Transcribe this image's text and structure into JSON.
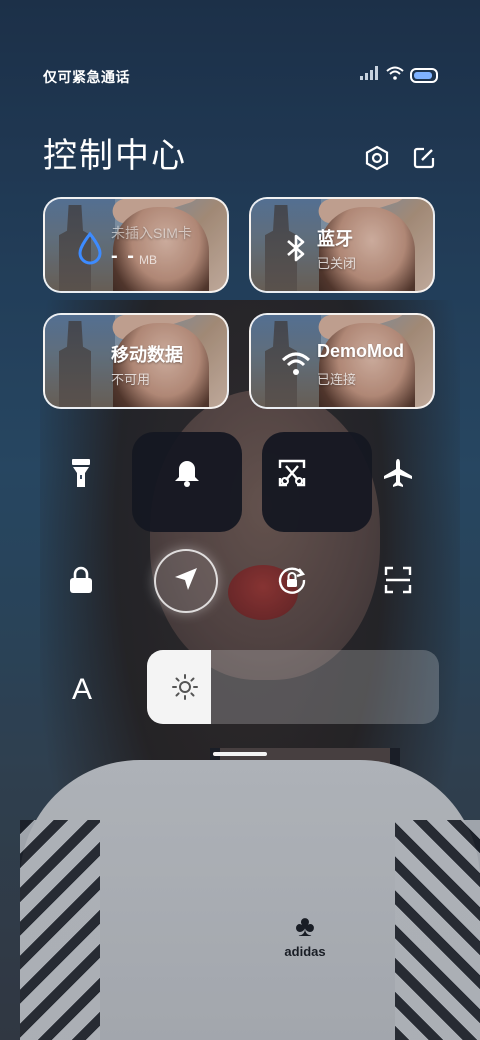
{
  "status_bar": {
    "carrier_text": "仅可紧急通话",
    "battery_level": 0.9,
    "icons": [
      "signal-icon",
      "wifi-icon",
      "battery-icon"
    ]
  },
  "header": {
    "title": "控制中心",
    "settings_icon": "gear-icon",
    "edit_icon": "edit-icon"
  },
  "tiles": {
    "sim": {
      "label": "未插入SIM卡",
      "value": "- -",
      "unit": "MB",
      "icon": "data-drop-icon"
    },
    "bluetooth": {
      "label": "蓝牙",
      "status": "已关闭",
      "icon": "bluetooth-icon"
    },
    "mobile_data": {
      "label": "移动数据",
      "status": "不可用",
      "icon": "mobile-data-icon"
    },
    "wifi": {
      "label": "DemoMod",
      "status": "已连接",
      "icon": "wifi-icon"
    }
  },
  "toggles_row1": [
    {
      "name": "flashlight",
      "icon": "flashlight-icon",
      "active": false
    },
    {
      "name": "mute",
      "icon": "bell-icon",
      "active": false
    },
    {
      "name": "screenshot",
      "icon": "screenshot-icon",
      "active": false
    },
    {
      "name": "airplane-mode",
      "icon": "airplane-icon",
      "active": false
    }
  ],
  "toggles_row2": [
    {
      "name": "lock-screen",
      "icon": "lock-icon",
      "active": false
    },
    {
      "name": "location",
      "icon": "location-arrow-icon",
      "active": true
    },
    {
      "name": "rotation-lock",
      "icon": "rotation-lock-icon",
      "active": false
    },
    {
      "name": "scanner",
      "icon": "scan-icon",
      "active": false
    }
  ],
  "brightness": {
    "font_label": "A",
    "level": 0.22,
    "icon": "sun-icon"
  },
  "colors": {
    "accent_blue": "#3d8bff",
    "battery_blue": "#7fb2ff"
  }
}
